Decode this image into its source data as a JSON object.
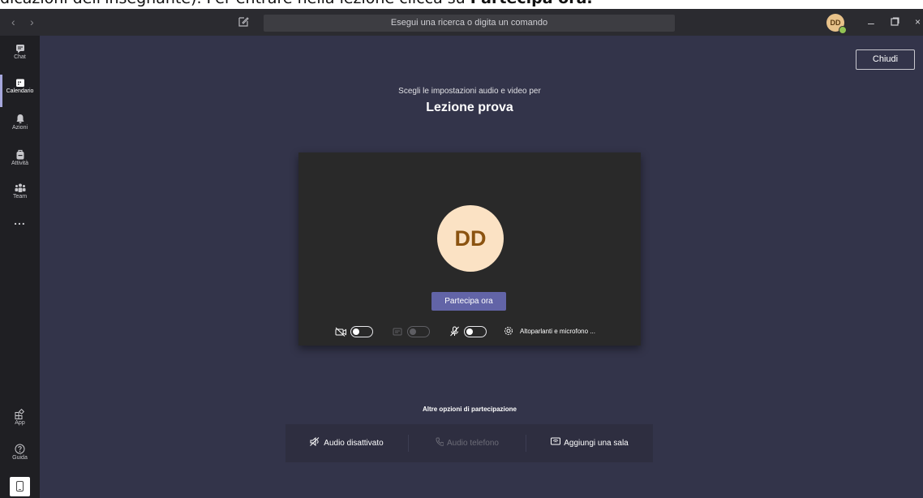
{
  "caption": {
    "text_before": "dicazioni dell'insegnante). Per entrare nella lezione clicca su ",
    "text_bold": "Partecipa ora."
  },
  "titlebar": {
    "search_placeholder": "Esegui una ricerca o digita un comando",
    "avatar_initials": "DD"
  },
  "rail": {
    "items": [
      {
        "label": "Chat",
        "icon": "chat-icon"
      },
      {
        "label": "Calendario",
        "icon": "calendar-icon",
        "active": true
      },
      {
        "label": "Azioni",
        "icon": "bell-icon"
      },
      {
        "label": "Attività",
        "icon": "backpack-icon"
      },
      {
        "label": "Team",
        "icon": "team-icon"
      },
      {
        "label": "...",
        "icon": "more-icon"
      }
    ],
    "bottom_items": [
      {
        "label": "App",
        "icon": "apps-icon"
      },
      {
        "label": "Guida",
        "icon": "help-icon"
      },
      {
        "label": "",
        "icon": "mobile-icon"
      }
    ]
  },
  "main": {
    "close_label": "Chiudi",
    "subtitle": "Scegli le impostazioni audio e video per",
    "meeting_title": "Lezione prova",
    "avatar_initials": "DD",
    "join_label": "Partecipa ora",
    "devices_label": "Altoparlanti e microfono ...",
    "other_options_title": "Altre opzioni di partecipazione",
    "options": [
      {
        "label": "Audio disattivato",
        "enabled": true
      },
      {
        "label": "Audio telefono",
        "enabled": false
      },
      {
        "label": "Aggiungi una sala",
        "enabled": true
      }
    ]
  },
  "colors": {
    "accent": "#6264a7",
    "background": "#33344a",
    "rail": "#1f1f23",
    "avatar": "#fbe2c4"
  }
}
